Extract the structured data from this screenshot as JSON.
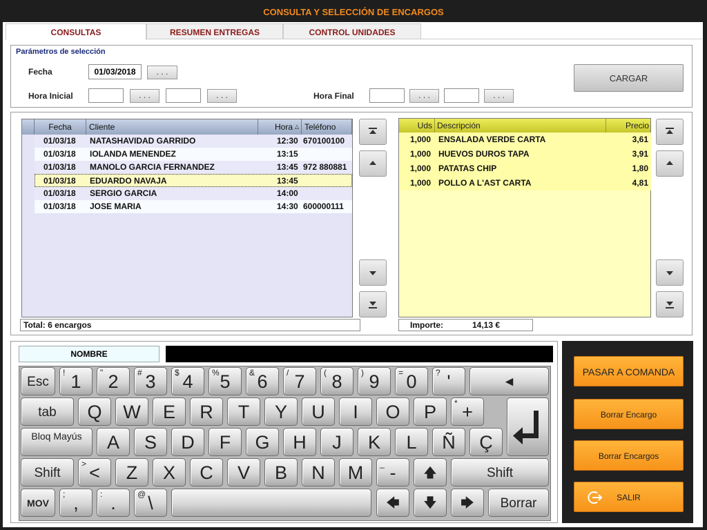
{
  "title": "CONSULTA Y SELECCIÓN DE ENCARGOS",
  "tabs": [
    {
      "label": "CONSULTAS"
    },
    {
      "label": "RESUMEN ENTREGAS"
    },
    {
      "label": "CONTROL UNIDADES"
    }
  ],
  "params": {
    "heading": "Parámetros de selección",
    "fecha_label": "Fecha",
    "fecha_value": "01/03/2018",
    "dots": ". . .",
    "hora_inicial_label": "Hora Inicial",
    "hora_final_label": "Hora Final",
    "cargar": "CARGAR"
  },
  "orders": {
    "columns": [
      "Fecha",
      "Cliente",
      "Hora",
      "Teléfono"
    ],
    "rows": [
      {
        "fecha": "01/03/18",
        "cliente": "NATASHAVIDAD GARRIDO",
        "hora": "12:30",
        "tel": "670100100"
      },
      {
        "fecha": "01/03/18",
        "cliente": "IOLANDA MENENDEZ",
        "hora": "13:15",
        "tel": ""
      },
      {
        "fecha": "01/03/18",
        "cliente": "MANOLO GARCIA FERNANDEZ",
        "hora": "13:45",
        "tel": "972 880881"
      },
      {
        "fecha": "01/03/18",
        "cliente": "EDUARDO NAVAJA",
        "hora": "13:45",
        "tel": ""
      },
      {
        "fecha": "01/03/18",
        "cliente": "SERGIO GARCIA",
        "hora": "14:00",
        "tel": ""
      },
      {
        "fecha": "01/03/18",
        "cliente": "JOSE MARIA",
        "hora": "14:30",
        "tel": "600000111"
      }
    ],
    "total": "Total: 6 encargos"
  },
  "lines": {
    "columns": [
      "Uds",
      "Descripción",
      "Precio"
    ],
    "rows": [
      {
        "uds": "1,000",
        "desc": "ENSALADA VERDE CARTA",
        "precio": "3,61"
      },
      {
        "uds": "1,000",
        "desc": "HUEVOS DUROS TAPA",
        "precio": "3,91"
      },
      {
        "uds": "1,000",
        "desc": "PATATAS CHIP",
        "precio": "1,80"
      },
      {
        "uds": "1,000",
        "desc": "POLLO A L'AST CARTA",
        "precio": "4,81"
      }
    ],
    "importe_label": "Importe:",
    "importe_value": "14,13 €"
  },
  "nombre_label": "NOMBRE",
  "keyboard": {
    "esc": "Esc",
    "row1": [
      {
        "main": "1",
        "sub": "!"
      },
      {
        "main": "2",
        "sub": "\""
      },
      {
        "main": "3",
        "sub": "#"
      },
      {
        "main": "4",
        "sub": "$"
      },
      {
        "main": "5",
        "sub": "%"
      },
      {
        "main": "6",
        "sub": "&"
      },
      {
        "main": "7",
        "sub": "/"
      },
      {
        "main": "8",
        "sub": "("
      },
      {
        "main": "9",
        "sub": ")"
      },
      {
        "main": "0",
        "sub": "="
      },
      {
        "main": "'",
        "sub": "?"
      }
    ],
    "back": "◄",
    "tab": "tab",
    "row2": [
      "Q",
      "W",
      "E",
      "R",
      "T",
      "Y",
      "U",
      "I",
      "O",
      "P"
    ],
    "plus": {
      "main": "+",
      "sub": "*"
    },
    "caps": "Bloq Mayús",
    "row3": [
      "A",
      "S",
      "D",
      "F",
      "G",
      "H",
      "J",
      "K",
      "L",
      "Ñ",
      "Ç"
    ],
    "shift": "Shift",
    "lt": {
      "main": "<",
      "sub": ">"
    },
    "row4": [
      "Z",
      "X",
      "C",
      "V",
      "B",
      "N",
      "M"
    ],
    "minus": {
      "main": "-",
      "sub": "_"
    },
    "up": "🡅",
    "mov": "MOV",
    "comma": {
      "main": ",",
      "sub": ";"
    },
    "period": {
      "main": ".",
      "sub": ":"
    },
    "backslash": {
      "main": "\\",
      "sub": "@"
    },
    "left": "🡄",
    "down": "🡇",
    "right": "🡆",
    "borrar": "Borrar"
  },
  "actions": {
    "pasar": "PASAR A COMANDA",
    "borrar_encargo": "Borrar Encargo",
    "borrar_encargos": "Borrar Encargos",
    "salir": "SALIR"
  },
  "colors": {
    "accent": "#f7931a",
    "title": "#f28a1e"
  }
}
